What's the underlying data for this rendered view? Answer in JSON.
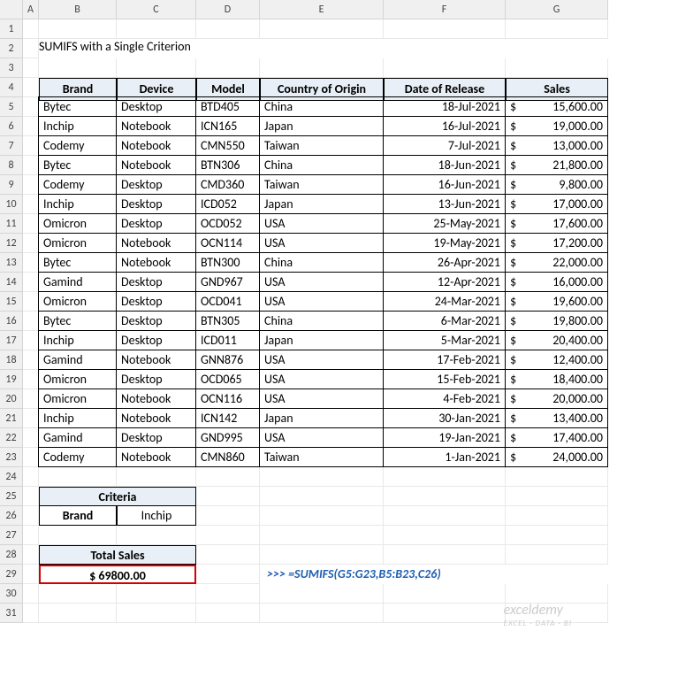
{
  "columns": [
    "A",
    "B",
    "C",
    "D",
    "E",
    "F",
    "G"
  ],
  "title": "SUMIFS with a Single Criterion",
  "headers": {
    "brand": "Brand",
    "device": "Device",
    "model": "Model",
    "country": "Country of Origin",
    "date": "Date of Release",
    "sales": "Sales"
  },
  "rows": [
    {
      "brand": "Bytec",
      "device": "Desktop",
      "model": "BTD405",
      "country": "China",
      "date": "18-Jul-2021",
      "sales": "15,600.00"
    },
    {
      "brand": "Inchip",
      "device": "Notebook",
      "model": "ICN165",
      "country": "Japan",
      "date": "16-Jul-2021",
      "sales": "19,000.00"
    },
    {
      "brand": "Codemy",
      "device": "Notebook",
      "model": "CMN550",
      "country": "Taiwan",
      "date": "7-Jul-2021",
      "sales": "13,000.00"
    },
    {
      "brand": "Bytec",
      "device": "Notebook",
      "model": "BTN306",
      "country": "China",
      "date": "18-Jun-2021",
      "sales": "21,800.00"
    },
    {
      "brand": "Codemy",
      "device": "Desktop",
      "model": "CMD360",
      "country": "Taiwan",
      "date": "16-Jun-2021",
      "sales": "9,800.00"
    },
    {
      "brand": "Inchip",
      "device": "Desktop",
      "model": "ICD052",
      "country": "Japan",
      "date": "13-Jun-2021",
      "sales": "17,000.00"
    },
    {
      "brand": "Omicron",
      "device": "Desktop",
      "model": "OCD052",
      "country": "USA",
      "date": "25-May-2021",
      "sales": "17,600.00"
    },
    {
      "brand": "Omicron",
      "device": "Notebook",
      "model": "OCN114",
      "country": "USA",
      "date": "19-May-2021",
      "sales": "17,200.00"
    },
    {
      "brand": "Bytec",
      "device": "Notebook",
      "model": "BTN300",
      "country": "China",
      "date": "26-Apr-2021",
      "sales": "22,000.00"
    },
    {
      "brand": "Gamind",
      "device": "Desktop",
      "model": "GND967",
      "country": "USA",
      "date": "12-Apr-2021",
      "sales": "16,000.00"
    },
    {
      "brand": "Omicron",
      "device": "Desktop",
      "model": "OCD041",
      "country": "USA",
      "date": "24-Mar-2021",
      "sales": "19,600.00"
    },
    {
      "brand": "Bytec",
      "device": "Desktop",
      "model": "BTN305",
      "country": "China",
      "date": "6-Mar-2021",
      "sales": "19,800.00"
    },
    {
      "brand": "Inchip",
      "device": "Desktop",
      "model": "ICD011",
      "country": "Japan",
      "date": "5-Mar-2021",
      "sales": "20,400.00"
    },
    {
      "brand": "Gamind",
      "device": "Notebook",
      "model": "GNN876",
      "country": "USA",
      "date": "17-Feb-2021",
      "sales": "12,400.00"
    },
    {
      "brand": "Omicron",
      "device": "Desktop",
      "model": "OCD065",
      "country": "USA",
      "date": "15-Feb-2021",
      "sales": "18,400.00"
    },
    {
      "brand": "Omicron",
      "device": "Notebook",
      "model": "OCN116",
      "country": "USA",
      "date": "4-Feb-2021",
      "sales": "20,000.00"
    },
    {
      "brand": "Inchip",
      "device": "Notebook",
      "model": "ICN142",
      "country": "Japan",
      "date": "30-Jan-2021",
      "sales": "13,400.00"
    },
    {
      "brand": "Gamind",
      "device": "Desktop",
      "model": "GND995",
      "country": "USA",
      "date": "19-Jan-2021",
      "sales": "17,400.00"
    },
    {
      "brand": "Codemy",
      "device": "Notebook",
      "model": "CMN860",
      "country": "Taiwan",
      "date": "1-Jan-2021",
      "sales": "24,000.00"
    }
  ],
  "criteria": {
    "header": "Criteria",
    "brandLabel": "Brand",
    "brandValue": "Inchip"
  },
  "total": {
    "header": "Total Sales",
    "value": "$   69800.00"
  },
  "formula": {
    "prefix": ">>> ",
    "text": "=SUMIFS(G5:G23,B5:B23,C26)"
  },
  "watermark": "exceldemy",
  "watermark2": "EXCEL · DATA · BI",
  "dollar": "$"
}
